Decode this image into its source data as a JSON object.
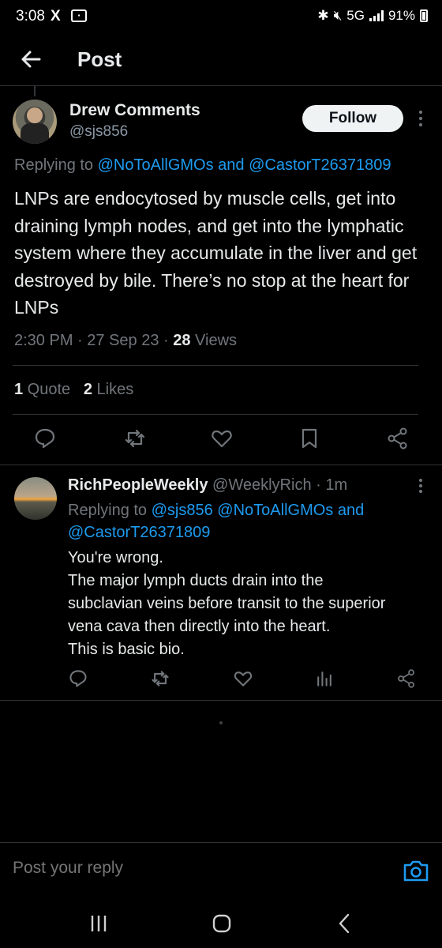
{
  "status_bar": {
    "time": "3:08",
    "x_logo": "X",
    "notif_icon": "notification-icon",
    "network": "5G",
    "battery": "91%"
  },
  "header": {
    "title": "Post"
  },
  "main_post": {
    "author_name": "Drew Comments",
    "author_handle": "@sjs856",
    "follow_label": "Follow",
    "replying_prefix": "Replying to ",
    "replying_mentions": "@NoToAllGMOs and @CastorT26371809",
    "text": "LNPs are endocytosed by muscle cells, get into draining lymph nodes, and get into the lymphatic system where they accumulate in the liver and get destroyed by bile. There’s no stop at the heart for LNPs",
    "time": "2:30 PM",
    "date": "27 Sep 23",
    "views_count": "28",
    "views_label": " Views",
    "quotes_count": "1",
    "quotes_label": " Quote",
    "likes_count": "2",
    "likes_label": " Likes"
  },
  "reply_post": {
    "author_name": "RichPeopleWeekly",
    "author_handle": "@WeeklyRich",
    "age": "1m",
    "replying_prefix": "Replying to ",
    "replying_mentions": "@sjs856 @NoToAllGMOs and @CastorT26371809",
    "lines": [
      "You're wrong.",
      "The major lymph ducts drain into the",
      "subclavian veins before transit to the superior",
      "vena cava then directly into the heart.",
      "This is basic bio."
    ]
  },
  "reply_bar": {
    "placeholder": "Post your reply"
  },
  "colors": {
    "background": "#000000",
    "accent": "#1d9bf0",
    "muted": "#71767b",
    "text": "#e7e9ea"
  }
}
